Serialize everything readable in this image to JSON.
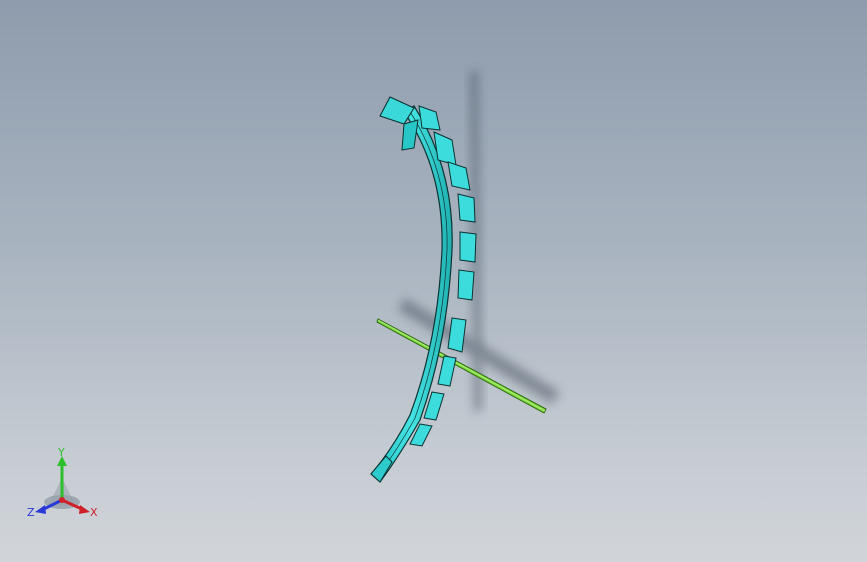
{
  "viewport": {
    "colors": {
      "part_face": "#33d6d6",
      "part_edge": "#0b3333",
      "shaft": "#7ddc3a",
      "shaft_edge": "#2f6b12"
    }
  },
  "triad": {
    "x_label": "X",
    "y_label": "Y",
    "z_label": "Z",
    "colors": {
      "x": "#d0202a",
      "y": "#2bbf2b",
      "z": "#2a3ad6"
    }
  }
}
